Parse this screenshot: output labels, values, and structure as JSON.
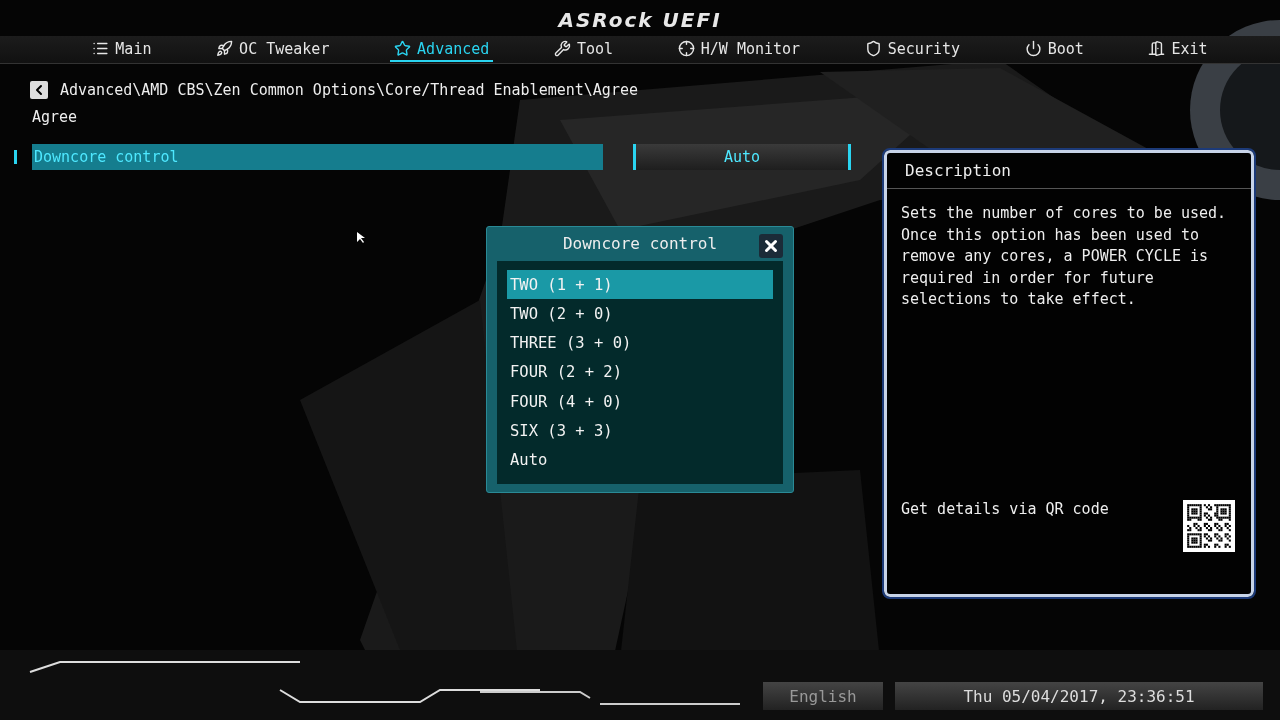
{
  "logo": "ASRock UEFI",
  "tabs": [
    {
      "label": "Main",
      "selected": false
    },
    {
      "label": "OC Tweaker",
      "selected": false
    },
    {
      "label": "Advanced",
      "selected": true
    },
    {
      "label": "Tool",
      "selected": false
    },
    {
      "label": "H/W Monitor",
      "selected": false
    },
    {
      "label": "Security",
      "selected": false
    },
    {
      "label": "Boot",
      "selected": false
    },
    {
      "label": "Exit",
      "selected": false
    }
  ],
  "breadcrumb": "Advanced\\AMD CBS\\Zen Common Options\\Core/Thread Enablement\\Agree",
  "page_title": "Agree",
  "settings": [
    {
      "label": "Downcore control",
      "value": "Auto",
      "selected": true
    }
  ],
  "popup": {
    "title": "Downcore control",
    "options": [
      {
        "label": "TWO (1 + 1)",
        "selected": true
      },
      {
        "label": "TWO (2 + 0)",
        "selected": false
      },
      {
        "label": "THREE (3 + 0)",
        "selected": false
      },
      {
        "label": "FOUR (2 + 2)",
        "selected": false
      },
      {
        "label": "FOUR (4 + 0)",
        "selected": false
      },
      {
        "label": "SIX (3 + 3)",
        "selected": false
      },
      {
        "label": "Auto",
        "selected": false
      }
    ]
  },
  "description": {
    "title": "Description",
    "text": "Sets the number of cores to be used. Once this option has been used to remove any cores, a POWER CYCLE is required in order for future selections to take effect.",
    "qr_label": "Get details via QR code"
  },
  "footer": {
    "language": "English",
    "datetime": "Thu 05/04/2017, 23:36:51"
  }
}
